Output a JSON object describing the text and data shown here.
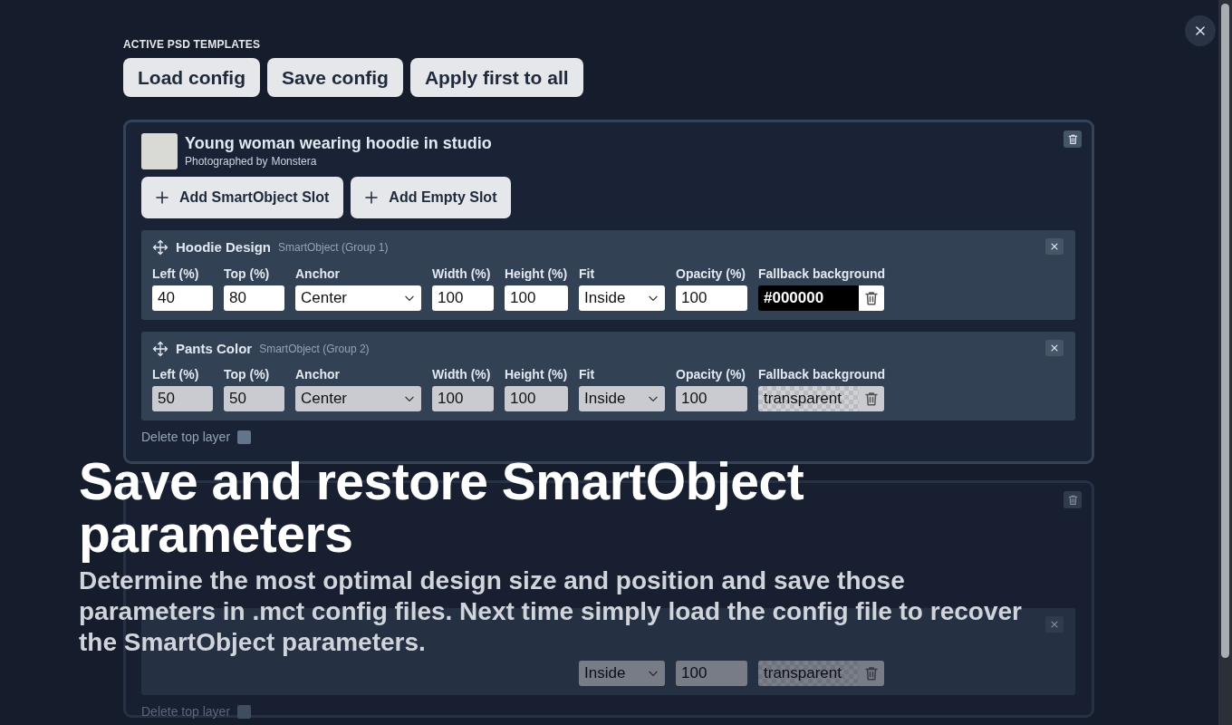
{
  "section_title": "ACTIVE PSD TEMPLATES",
  "toolbar": [
    "Load config",
    "Save config",
    "Apply first to all"
  ],
  "templates": [
    {
      "title": "Young woman wearing hoodie in studio",
      "credit_prefix": "Photographed by",
      "credit_author": "Monstera",
      "buttons": [
        "Add SmartObject Slot",
        "Add Empty Slot"
      ],
      "slots": [
        {
          "name": "Hoodie Design",
          "type": "SmartObject (Group 1)",
          "disabled": false,
          "fields": [
            {
              "kind": "input",
              "label": "Left (%)",
              "value": "40"
            },
            {
              "kind": "input",
              "label": "Top (%)",
              "value": "80"
            },
            {
              "kind": "select",
              "label": "Anchor",
              "value": "Center"
            },
            {
              "kind": "input",
              "label": "Width (%)",
              "value": "100"
            },
            {
              "kind": "input",
              "label": "Height (%)",
              "value": "100"
            },
            {
              "kind": "select",
              "label": "Fit",
              "value": "Inside"
            },
            {
              "kind": "input",
              "label": "Opacity (%)",
              "value": "100"
            },
            {
              "kind": "solidcolor",
              "label": "Fallback background",
              "value": "#000000"
            }
          ]
        },
        {
          "name": "Pants Color",
          "type": "SmartObject (Group 2)",
          "disabled": true,
          "fields": [
            {
              "kind": "input",
              "label": "Left (%)",
              "value": "50"
            },
            {
              "kind": "input",
              "label": "Top (%)",
              "value": "50"
            },
            {
              "kind": "select",
              "label": "Anchor",
              "value": "Center"
            },
            {
              "kind": "input",
              "label": "Width (%)",
              "value": "100"
            },
            {
              "kind": "input",
              "label": "Height (%)",
              "value": "100"
            },
            {
              "kind": "select",
              "label": "Fit",
              "value": "Inside"
            },
            {
              "kind": "input",
              "label": "Opacity (%)",
              "value": "100"
            },
            {
              "kind": "transparent",
              "label": "Fallback background",
              "value": "transparent"
            }
          ]
        }
      ],
      "delete_top_layer": {
        "label": "Delete top layer",
        "checked": false
      }
    },
    {
      "slots": [
        {
          "disabled": true,
          "fields": [
            {
              "kind": "select",
              "value": "Inside"
            },
            {
              "kind": "input",
              "value": "100"
            },
            {
              "kind": "transparent",
              "value": "transparent"
            }
          ]
        }
      ],
      "delete_top_layer": {
        "label": "Delete top layer",
        "checked": false
      }
    }
  ],
  "headline": "Save and restore SmartObject parameters",
  "description": "Determine the most optimal design size and position and save those parameters in .mct config files. Next time simply load the config file to recover the SmartObject parameters."
}
